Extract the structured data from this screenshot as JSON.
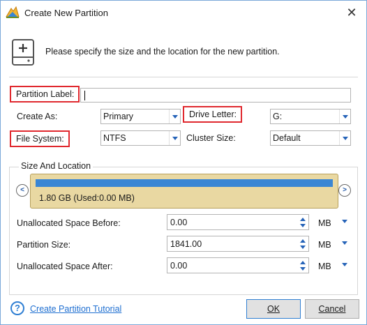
{
  "window": {
    "title": "Create New Partition"
  },
  "header": {
    "instruction": "Please specify the size and the location for the new partition."
  },
  "form": {
    "partition_label": {
      "label": "Partition Label:",
      "value": ""
    },
    "create_as": {
      "label": "Create As:",
      "value": "Primary"
    },
    "drive_letter": {
      "label": "Drive Letter:",
      "value": "G:"
    },
    "file_system": {
      "label": "File System:",
      "value": "NTFS"
    },
    "cluster_size": {
      "label": "Cluster Size:",
      "value": "Default"
    }
  },
  "size_location": {
    "title": "Size And Location",
    "partition_info": "1.80 GB (Used:0.00 MB)",
    "used_fraction": 0.0,
    "fields": [
      {
        "label": "Unallocated Space Before:",
        "value": "0.00",
        "unit": "MB"
      },
      {
        "label": "Partition Size:",
        "value": "1841.00",
        "unit": "MB"
      },
      {
        "label": "Unallocated Space After:",
        "value": "0.00",
        "unit": "MB"
      }
    ]
  },
  "footer": {
    "help_link": "Create Partition Tutorial",
    "ok_label": "OK",
    "cancel_label": "Cancel"
  },
  "icons": {
    "app": "app-logo-icon",
    "close": "close-icon",
    "disk": "disk-add-icon",
    "help": "help-icon",
    "left": "chevron-left-icon",
    "right": "chevron-right-icon"
  },
  "colors": {
    "accent": "#2563b8",
    "highlight": "#e0282e",
    "partition_bar": "#e9d8a2",
    "used_bar": "#3a86d4"
  }
}
